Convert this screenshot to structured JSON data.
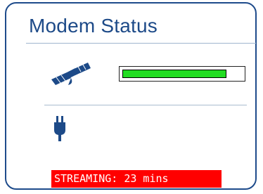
{
  "panel": {
    "title": "Modem Status",
    "border_color": "#1e4b8b",
    "title_color": "#1d4a88"
  },
  "satellite": {
    "icon": "satellite-icon",
    "signal_fraction": 0.87,
    "signal_color": "#22dd22"
  },
  "power": {
    "icon": "power-plug-icon"
  },
  "status": {
    "text": "STREAMING: 23 mins",
    "background": "#ff0000",
    "color": "#ffffff"
  }
}
